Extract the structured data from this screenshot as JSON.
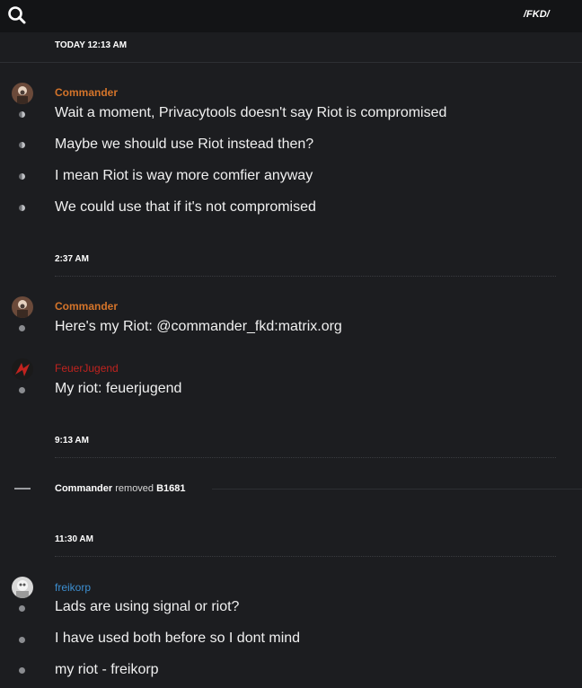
{
  "header": {
    "channel": "/FKD/",
    "search_icon": "search-icon"
  },
  "colors": {
    "commander": "#d4742a",
    "feuerjugend": "#c0231f",
    "freikorp": "#3d8fd1"
  },
  "timestamps": {
    "t1": "TODAY 12:13 AM",
    "t2": "2:37 AM",
    "t3": "9:13 AM",
    "t4": "11:30 AM"
  },
  "groups": {
    "g1": {
      "user": "Commander",
      "messages": [
        "Wait a moment, Privacytools doesn't say Riot is compromised",
        "Maybe we should use Riot instead then?",
        "I mean Riot is way more comfier anyway",
        "We could use that if it's not compromised"
      ]
    },
    "g2": {
      "user": "Commander",
      "messages": [
        "Here's my Riot: @commander_fkd:matrix.org"
      ]
    },
    "g3": {
      "user": "FeuerJugend",
      "messages": [
        "My riot: feuerjugend"
      ]
    },
    "g4": {
      "user": "freikorp",
      "messages": [
        "Lads are using signal or riot?",
        "I have used both before so I dont mind",
        "my riot - freikorp"
      ]
    }
  },
  "system_event": {
    "actor": "Commander",
    "action": "removed",
    "target": "B1681"
  }
}
